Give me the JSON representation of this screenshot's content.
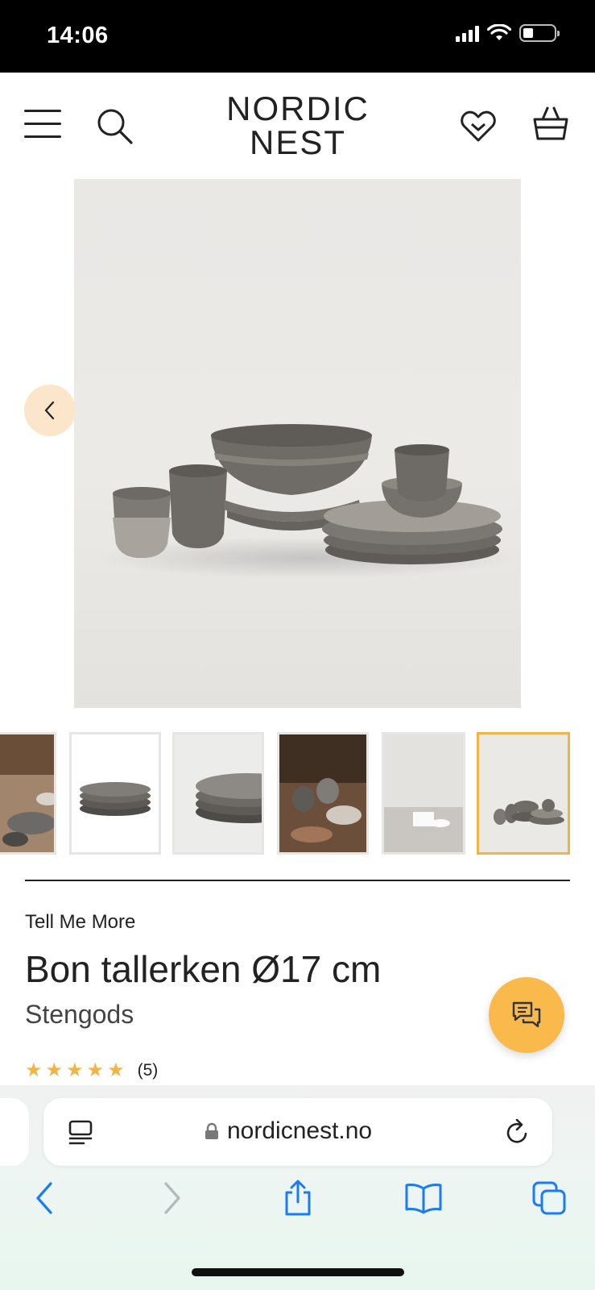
{
  "status_bar": {
    "time": "14:06"
  },
  "header": {
    "logo_line1": "NORDIC",
    "logo_line2": "NEST"
  },
  "product": {
    "brand": "Tell Me More",
    "title": "Bon tallerken Ø17 cm",
    "material": "Stengods",
    "rating_stars": 5,
    "rating_count": "(5)"
  },
  "browser": {
    "url": "nordicnest.no"
  },
  "colors": {
    "accent": "#f4b445",
    "chat_button": "#f9b94b",
    "prev_button_bg": "#fbe6cb",
    "safari_blue": "#1a7cf5"
  },
  "icons": {
    "menu": "menu-icon",
    "search": "search-icon",
    "favorites": "heart-icon",
    "cart": "basket-icon",
    "prev": "chevron-left-icon",
    "chat": "chat-icon",
    "reader": "reader-icon",
    "lock": "lock-icon",
    "reload": "reload-icon",
    "back": "chevron-left-icon",
    "forward": "chevron-right-icon",
    "share": "share-icon",
    "bookmarks": "book-icon",
    "tabs": "tabs-icon"
  }
}
